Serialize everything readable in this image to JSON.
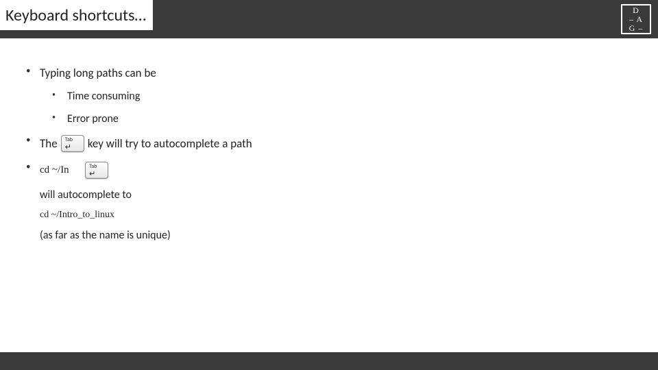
{
  "header": {
    "title": "Keyboard shortcuts…",
    "logo": {
      "line1": "D",
      "line2": "– A",
      "line3": "G –"
    }
  },
  "bullets": {
    "item1": "Typing long paths can be",
    "item1_sub1": "Time consuming",
    "item1_sub2": "Error prone",
    "item2_pre": "The",
    "item2_post": "key  will try to autocomplete a path",
    "item3_code": "cd ~/In",
    "item3_line2": "will autocomplete to",
    "item3_code2": "cd ~/Intro_to_linux",
    "item3_line3": "(as far as the name is unique)"
  },
  "key": {
    "label": "Tab",
    "arrow": "↵"
  }
}
